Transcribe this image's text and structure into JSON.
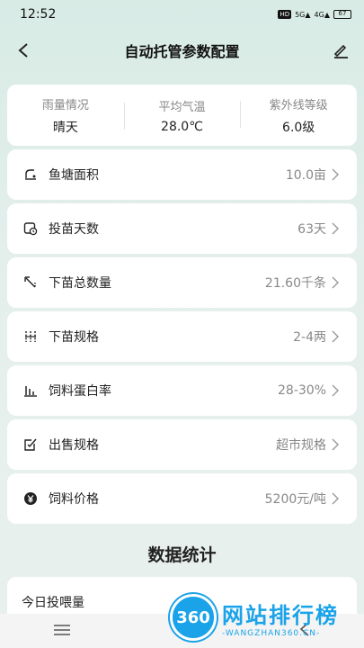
{
  "status": {
    "time": "12:52",
    "battery": "67"
  },
  "header": {
    "title": "自动托管参数配置"
  },
  "weather": [
    {
      "label": "雨量情况",
      "value": "晴天"
    },
    {
      "label": "平均气温",
      "value": "28.0℃"
    },
    {
      "label": "紫外线等级",
      "value": "6.0级"
    }
  ],
  "params": [
    {
      "icon": "pond-area-icon",
      "label": "鱼塘面积",
      "value": "10.0亩"
    },
    {
      "icon": "clock-calendar-icon",
      "label": "投苗天数",
      "value": "63天"
    },
    {
      "icon": "diagonal-arrow-icon",
      "label": "下苗总数量",
      "value": "21.60千条"
    },
    {
      "icon": "dotted-grid-icon",
      "label": "下苗规格",
      "value": "2-4两"
    },
    {
      "icon": "bar-chart-icon",
      "label": "饲料蛋白率",
      "value": "28-30%"
    },
    {
      "icon": "checkbox-edit-icon",
      "label": "出售规格",
      "value": "超市规格"
    },
    {
      "icon": "yuan-coin-icon",
      "label": "饲料价格",
      "value": "5200元/吨"
    }
  ],
  "stats": {
    "section_title": "数据统计",
    "first_item": "今日投喂量"
  },
  "watermark": {
    "logo": "360",
    "cn": "网站排行榜",
    "en": "-WANGZHAN360.CN-"
  }
}
